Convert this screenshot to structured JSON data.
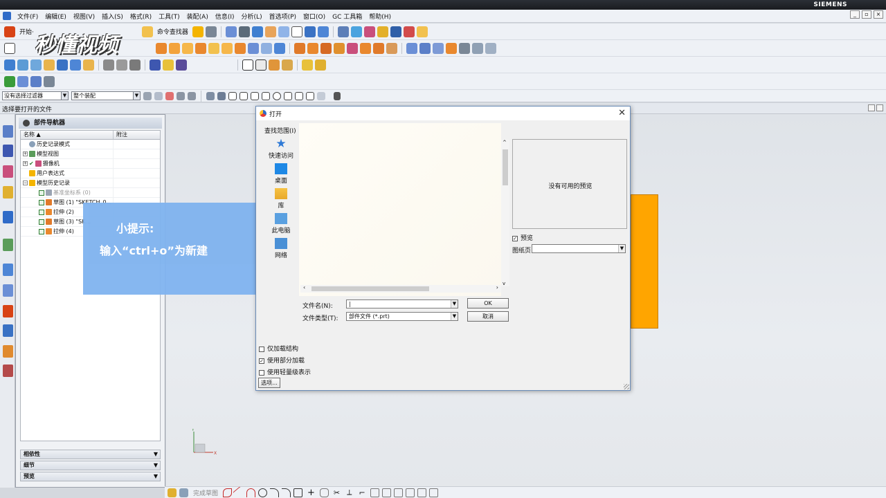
{
  "brand": "SIEMENS",
  "menu": [
    "文件(F)",
    "编辑(E)",
    "视图(V)",
    "插入(S)",
    "格式(R)",
    "工具(T)",
    "装配(A)",
    "信息(I)",
    "分析(L)",
    "首选项(P)",
    "窗口(O)",
    "GC 工具箱",
    "帮助(H)"
  ],
  "toolbar": {
    "start_label": "开始·",
    "command_finder_label": "命令查找器"
  },
  "watermark": "秒懂视频",
  "filter": {
    "selection_filter": "没有选择过滤器",
    "assembly_scope": "整个装配"
  },
  "status_prompt": "选择要打开的文件",
  "navigator": {
    "title": "部件导航器",
    "col_name": "名称",
    "col_note": "附注",
    "rows": [
      {
        "label": "历史记录模式",
        "style": "plain"
      },
      {
        "label": "模型视图",
        "style": "expand"
      },
      {
        "label": "摄像机",
        "style": "expand"
      },
      {
        "label": "用户表达式",
        "style": "plain"
      },
      {
        "label": "模型历史记录",
        "style": "expand"
      },
      {
        "label": "基准坐标系 (0)",
        "style": "child-dim"
      },
      {
        "label": "草图 (1) \"SKETCH_0...",
        "style": "child"
      },
      {
        "label": "拉伸 (2)",
        "style": "child"
      },
      {
        "label": "草图 (3) \"SK...",
        "style": "child"
      },
      {
        "label": "拉伸 (4)",
        "style": "child"
      }
    ],
    "panels": [
      "相依性",
      "细节",
      "预览"
    ]
  },
  "tip": {
    "title": "小提示:",
    "body": "输入“ctrl+o”为新建"
  },
  "dialog": {
    "title": "打开",
    "look_in_label": "查找范围(I)",
    "places": [
      "快速访问",
      "桌面",
      "库",
      "此电脑",
      "网络"
    ],
    "no_preview": "没有可用的预览",
    "preview_checkbox": "预览",
    "sheet_label": "图纸页",
    "filename_label": "文件名(N):",
    "filename_value": "|",
    "filetype_label": "文件类型(T):",
    "filetype_value": "部件文件 (*.prt)",
    "ok": "OK",
    "cancel": "取消",
    "options": [
      {
        "label": "仅加载结构",
        "checked": false
      },
      {
        "label": "使用部分加载",
        "checked": true
      },
      {
        "label": "使用轻量级表示",
        "checked": false
      }
    ],
    "options_button": "选项..."
  },
  "sketch_bar": {
    "finish_label": "完成草图"
  },
  "triad": {
    "x": "X",
    "y": "Y"
  },
  "colors": {
    "accent_orange": "#FFA500",
    "tip_blue": "#7FB3EF",
    "siemens_bar": "#1A1C20"
  }
}
